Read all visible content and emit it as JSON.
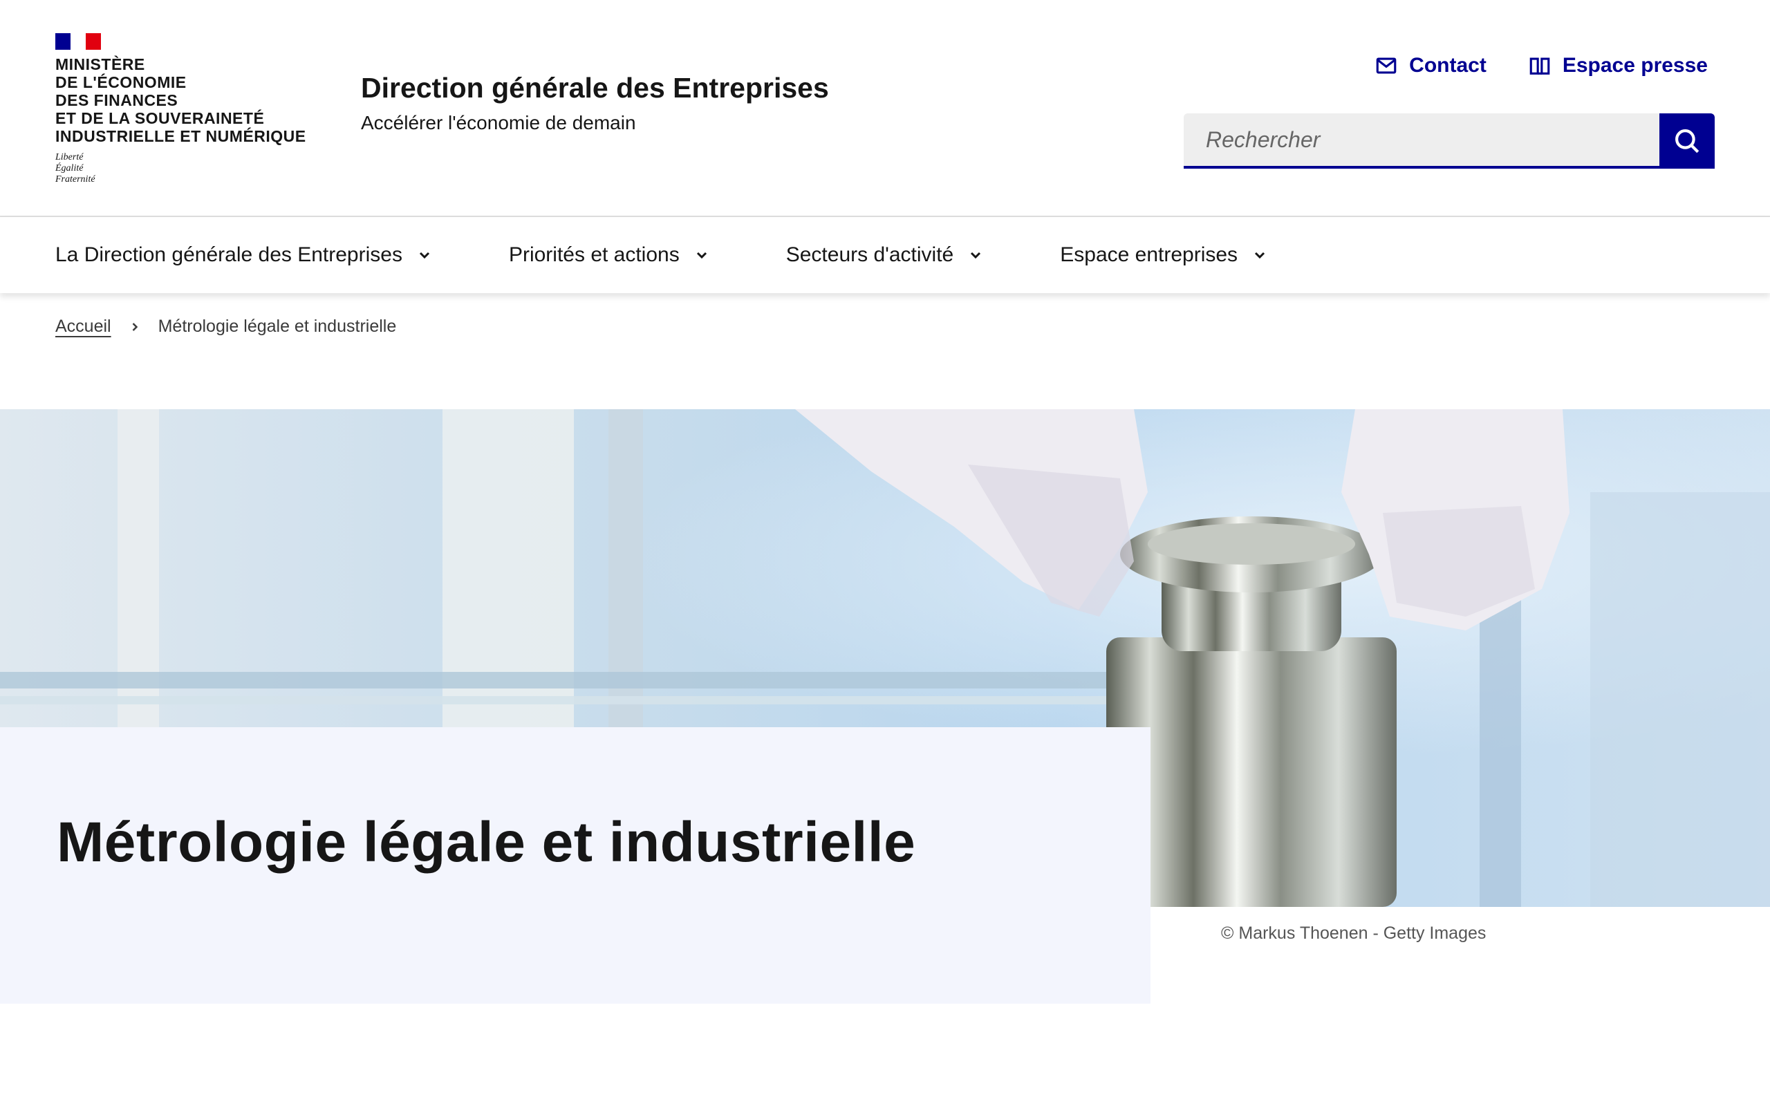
{
  "header": {
    "ministry_lines": [
      "Ministère",
      "de l'Économie",
      "des Finances",
      "et de la Souveraineté",
      "industrielle et numérique"
    ],
    "motto": [
      "Liberté",
      "Égalité",
      "Fraternité"
    ],
    "site_title": "Direction générale des Entreprises",
    "tagline": "Accélérer l'économie de demain",
    "tools": {
      "contact": "Contact",
      "press": "Espace presse"
    },
    "search": {
      "placeholder": "Rechercher"
    }
  },
  "nav": {
    "items": [
      {
        "label": "La Direction générale des Entreprises"
      },
      {
        "label": "Priorités et actions"
      },
      {
        "label": "Secteurs d'activité"
      },
      {
        "label": "Espace entreprises"
      }
    ]
  },
  "breadcrumb": {
    "home": "Accueil",
    "current": "Métrologie légale et industrielle"
  },
  "hero": {
    "title": "Métrologie légale et industrielle",
    "credit": "© Markus Thoenen - Getty Images"
  },
  "colors": {
    "brand_blue": "#000091",
    "brand_red": "#e1000f",
    "hero_card_bg": "#f3f5fd"
  }
}
